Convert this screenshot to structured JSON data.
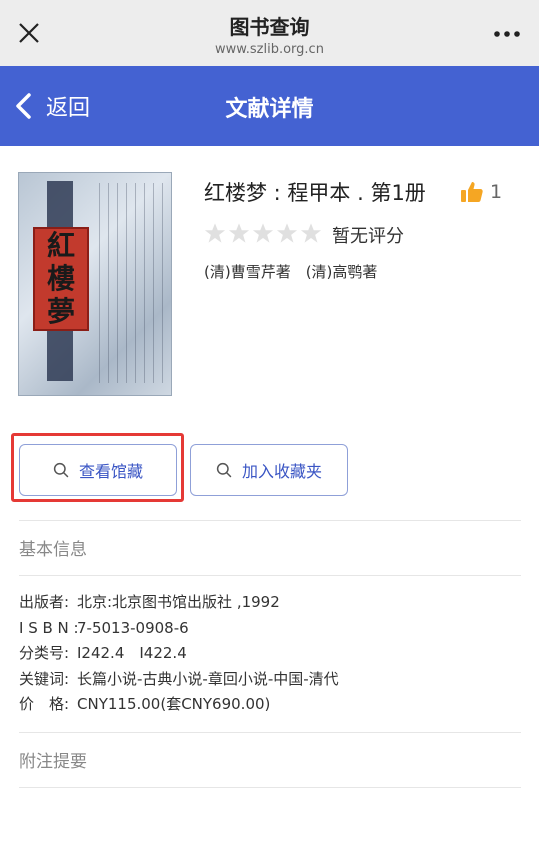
{
  "topbar": {
    "title": "图书查询",
    "url": "www.szlib.org.cn",
    "close_icon": "close-icon",
    "more_icon": "more-icon"
  },
  "header": {
    "back_label": "返回",
    "title": "文献详情"
  },
  "book": {
    "cover_chars": [
      "紅",
      "樓",
      "夢"
    ],
    "title": "红楼梦 : 程甲本 . 第1册",
    "likes": "1",
    "rating_text": "暂无评分",
    "rating_value": 0,
    "authors": "(清)曹雪芹著　(清)高鹗著"
  },
  "buttons": {
    "view_holdings": "查看馆藏",
    "add_favorites": "加入收藏夹"
  },
  "basic_info": {
    "section_title": "基本信息",
    "rows": [
      {
        "label": "出版者:",
        "value": "北京:北京图书馆出版社 ,1992"
      },
      {
        "label": "I S B N :",
        "value": "7-5013-0908-6"
      },
      {
        "label": "分类号:",
        "value": "I242.4　I422.4"
      },
      {
        "label": "关键词:",
        "value": "长篇小说-古典小说-章回小说-中国-清代"
      },
      {
        "label": "价　格:",
        "value": "CNY115.00(套CNY690.00)"
      }
    ]
  },
  "notes": {
    "section_title": "附注提要"
  },
  "colors": {
    "header_bg": "#4462d2",
    "button_text": "#3a55c4",
    "highlight": "#e53935",
    "like_icon": "#f5a623",
    "empty_star": "#e0e0e0"
  }
}
